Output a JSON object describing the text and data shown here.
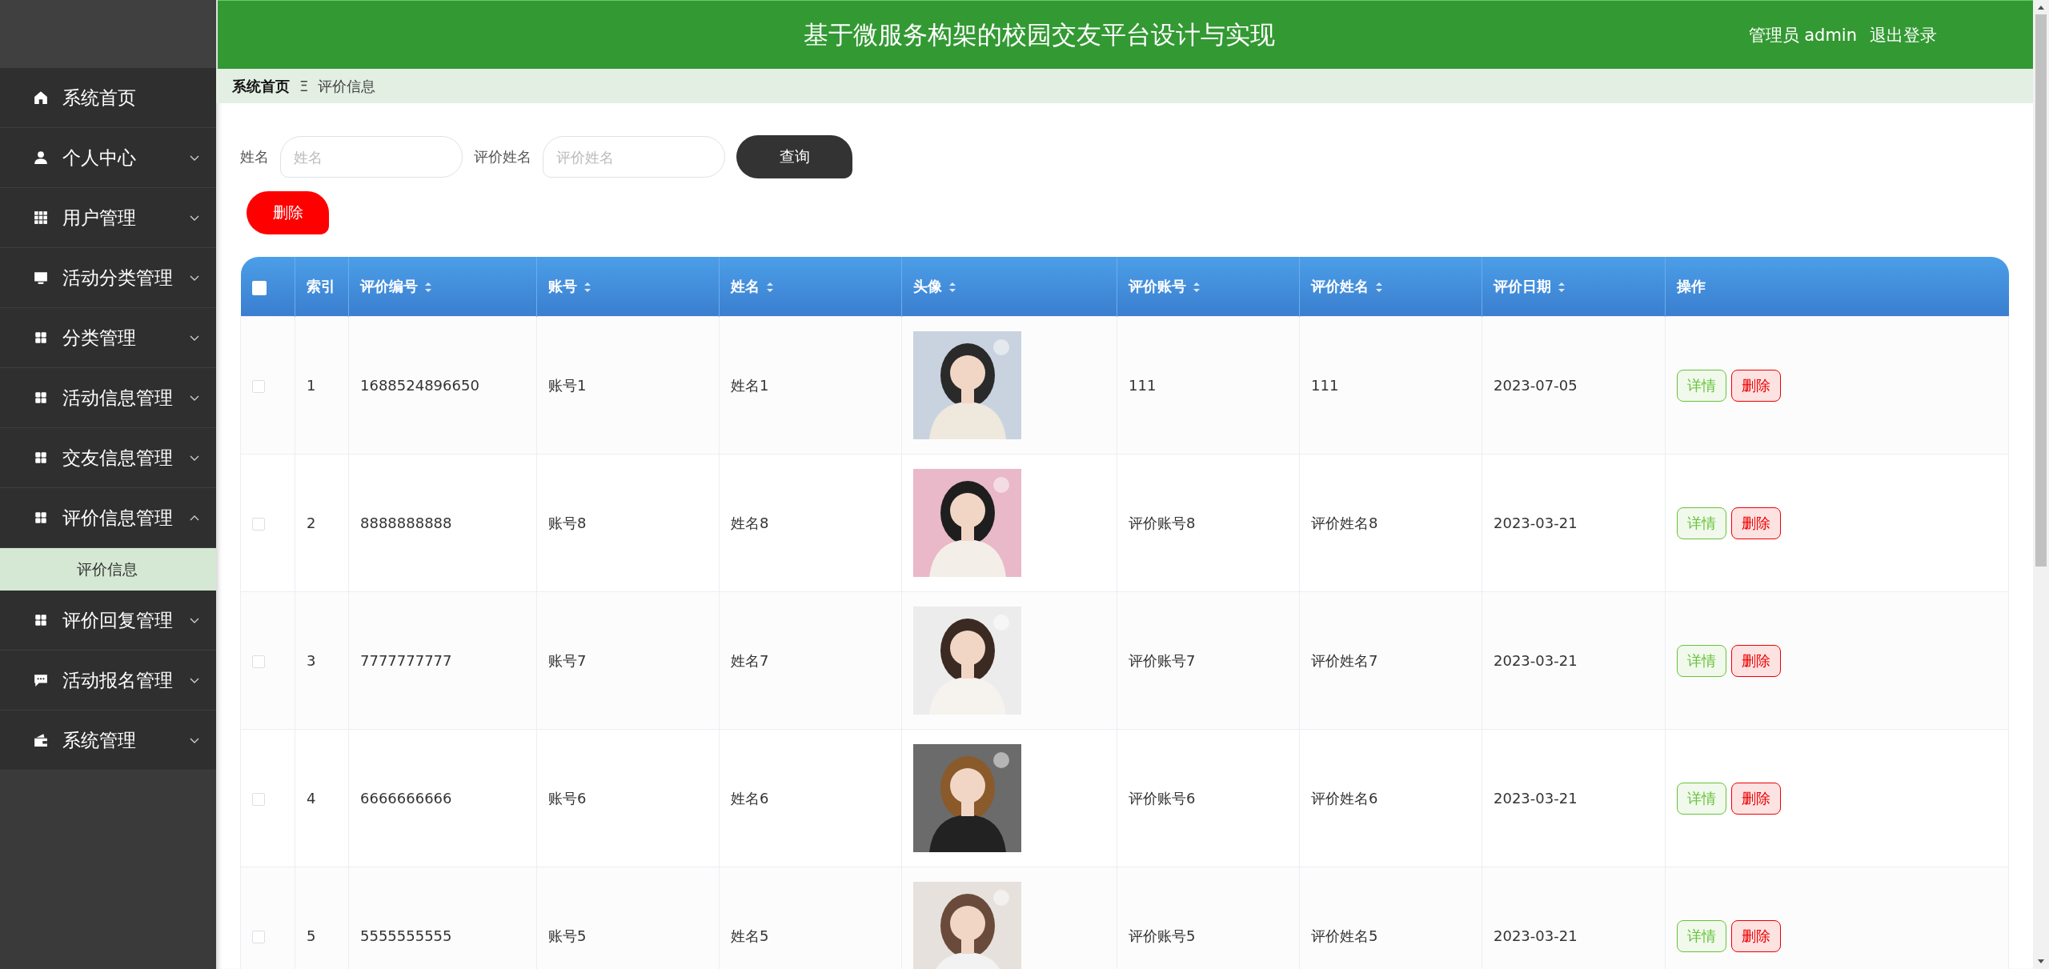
{
  "sidebar": {
    "items": [
      {
        "label": "系统首页"
      },
      {
        "label": "个人中心",
        "expanded": false
      },
      {
        "label": "用户管理",
        "expanded": false
      },
      {
        "label": "活动分类管理",
        "expanded": false
      },
      {
        "label": "分类管理",
        "expanded": false
      },
      {
        "label": "活动信息管理",
        "expanded": false
      },
      {
        "label": "交友信息管理",
        "expanded": false
      },
      {
        "label": "评价信息管理",
        "expanded": true,
        "children": [
          {
            "label": "评价信息",
            "selected": true
          }
        ]
      },
      {
        "label": "评价回复管理",
        "expanded": false
      },
      {
        "label": "活动报名管理",
        "expanded": false
      },
      {
        "label": "系统管理",
        "expanded": false
      }
    ]
  },
  "header": {
    "title": "基于微服务构架的校园交友平台设计与实现",
    "user": "管理员 admin",
    "logout": "退出登录"
  },
  "breadcrumb": {
    "items": [
      "系统首页",
      "评价信息"
    ],
    "separator": "Ξ"
  },
  "search": {
    "fields": [
      {
        "label": "姓名",
        "placeholder": "姓名"
      },
      {
        "label": "评价姓名",
        "placeholder": "评价姓名"
      }
    ],
    "query_button": "查询",
    "delete_button": "删除"
  },
  "table": {
    "select_all": {
      "checked": false
    },
    "columns": [
      {
        "label": "索引",
        "sortable": false
      },
      {
        "label": "评价编号",
        "sortable": true
      },
      {
        "label": "账号",
        "sortable": true
      },
      {
        "label": "姓名",
        "sortable": true
      },
      {
        "label": "头像",
        "sortable": true
      },
      {
        "label": "评价账号",
        "sortable": true
      },
      {
        "label": "评价姓名",
        "sortable": true
      },
      {
        "label": "评价日期",
        "sortable": true
      },
      {
        "label": "操作",
        "sortable": false
      }
    ],
    "rows": [
      {
        "checked": false,
        "cells": [
          "1",
          "1688524896650",
          "账号1",
          "姓名1",
          {
            "kind": "picture"
          },
          "111",
          "111",
          "2023-07-05"
        ],
        "actions": [
          "详情",
          "删除"
        ]
      },
      {
        "checked": false,
        "cells": [
          "2",
          "8888888888",
          "账号8",
          "姓名8",
          {
            "kind": "picture"
          },
          "评价账号8",
          "评价姓名8",
          "2023-03-21"
        ],
        "actions": [
          "详情",
          "删除"
        ]
      },
      {
        "checked": false,
        "cells": [
          "3",
          "7777777777",
          "账号7",
          "姓名7",
          {
            "kind": "picture"
          },
          "评价账号7",
          "评价姓名7",
          "2023-03-21"
        ],
        "actions": [
          "详情",
          "删除"
        ]
      },
      {
        "checked": false,
        "cells": [
          "4",
          "6666666666",
          "账号6",
          "姓名6",
          {
            "kind": "picture"
          },
          "评价账号6",
          "评价姓名6",
          "2023-03-21"
        ],
        "actions": [
          "详情",
          "删除"
        ]
      },
      {
        "checked": false,
        "cells": [
          "5",
          "5555555555",
          "账号5",
          "姓名5",
          {
            "kind": "picture"
          },
          "评价账号5",
          "评价姓名5",
          "2023-03-21"
        ],
        "actions": [
          "详情",
          "删除"
        ]
      }
    ]
  }
}
